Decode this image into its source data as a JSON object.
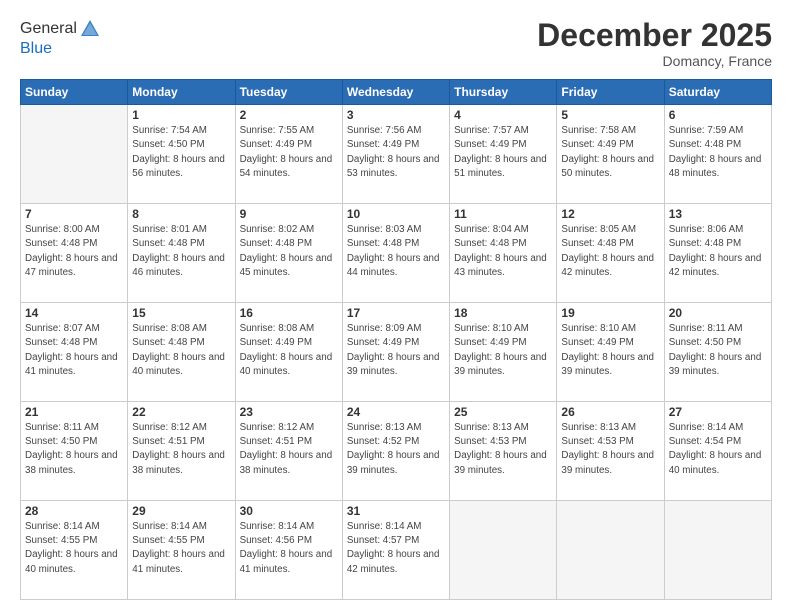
{
  "header": {
    "logo": {
      "line1": "General",
      "line2": "Blue"
    },
    "title": "December 2025",
    "location": "Domancy, France"
  },
  "calendar": {
    "weekdays": [
      "Sunday",
      "Monday",
      "Tuesday",
      "Wednesday",
      "Thursday",
      "Friday",
      "Saturday"
    ],
    "weeks": [
      [
        {
          "day": "",
          "empty": true
        },
        {
          "day": "1",
          "sunrise": "7:54 AM",
          "sunset": "4:50 PM",
          "daylight": "8 hours and 56 minutes."
        },
        {
          "day": "2",
          "sunrise": "7:55 AM",
          "sunset": "4:49 PM",
          "daylight": "8 hours and 54 minutes."
        },
        {
          "day": "3",
          "sunrise": "7:56 AM",
          "sunset": "4:49 PM",
          "daylight": "8 hours and 53 minutes."
        },
        {
          "day": "4",
          "sunrise": "7:57 AM",
          "sunset": "4:49 PM",
          "daylight": "8 hours and 51 minutes."
        },
        {
          "day": "5",
          "sunrise": "7:58 AM",
          "sunset": "4:49 PM",
          "daylight": "8 hours and 50 minutes."
        },
        {
          "day": "6",
          "sunrise": "7:59 AM",
          "sunset": "4:48 PM",
          "daylight": "8 hours and 48 minutes."
        }
      ],
      [
        {
          "day": "7",
          "sunrise": "8:00 AM",
          "sunset": "4:48 PM",
          "daylight": "8 hours and 47 minutes."
        },
        {
          "day": "8",
          "sunrise": "8:01 AM",
          "sunset": "4:48 PM",
          "daylight": "8 hours and 46 minutes."
        },
        {
          "day": "9",
          "sunrise": "8:02 AM",
          "sunset": "4:48 PM",
          "daylight": "8 hours and 45 minutes."
        },
        {
          "day": "10",
          "sunrise": "8:03 AM",
          "sunset": "4:48 PM",
          "daylight": "8 hours and 44 minutes."
        },
        {
          "day": "11",
          "sunrise": "8:04 AM",
          "sunset": "4:48 PM",
          "daylight": "8 hours and 43 minutes."
        },
        {
          "day": "12",
          "sunrise": "8:05 AM",
          "sunset": "4:48 PM",
          "daylight": "8 hours and 42 minutes."
        },
        {
          "day": "13",
          "sunrise": "8:06 AM",
          "sunset": "4:48 PM",
          "daylight": "8 hours and 42 minutes."
        }
      ],
      [
        {
          "day": "14",
          "sunrise": "8:07 AM",
          "sunset": "4:48 PM",
          "daylight": "8 hours and 41 minutes."
        },
        {
          "day": "15",
          "sunrise": "8:08 AM",
          "sunset": "4:48 PM",
          "daylight": "8 hours and 40 minutes."
        },
        {
          "day": "16",
          "sunrise": "8:08 AM",
          "sunset": "4:49 PM",
          "daylight": "8 hours and 40 minutes."
        },
        {
          "day": "17",
          "sunrise": "8:09 AM",
          "sunset": "4:49 PM",
          "daylight": "8 hours and 39 minutes."
        },
        {
          "day": "18",
          "sunrise": "8:10 AM",
          "sunset": "4:49 PM",
          "daylight": "8 hours and 39 minutes."
        },
        {
          "day": "19",
          "sunrise": "8:10 AM",
          "sunset": "4:49 PM",
          "daylight": "8 hours and 39 minutes."
        },
        {
          "day": "20",
          "sunrise": "8:11 AM",
          "sunset": "4:50 PM",
          "daylight": "8 hours and 39 minutes."
        }
      ],
      [
        {
          "day": "21",
          "sunrise": "8:11 AM",
          "sunset": "4:50 PM",
          "daylight": "8 hours and 38 minutes."
        },
        {
          "day": "22",
          "sunrise": "8:12 AM",
          "sunset": "4:51 PM",
          "daylight": "8 hours and 38 minutes."
        },
        {
          "day": "23",
          "sunrise": "8:12 AM",
          "sunset": "4:51 PM",
          "daylight": "8 hours and 38 minutes."
        },
        {
          "day": "24",
          "sunrise": "8:13 AM",
          "sunset": "4:52 PM",
          "daylight": "8 hours and 39 minutes."
        },
        {
          "day": "25",
          "sunrise": "8:13 AM",
          "sunset": "4:53 PM",
          "daylight": "8 hours and 39 minutes."
        },
        {
          "day": "26",
          "sunrise": "8:13 AM",
          "sunset": "4:53 PM",
          "daylight": "8 hours and 39 minutes."
        },
        {
          "day": "27",
          "sunrise": "8:14 AM",
          "sunset": "4:54 PM",
          "daylight": "8 hours and 40 minutes."
        }
      ],
      [
        {
          "day": "28",
          "sunrise": "8:14 AM",
          "sunset": "4:55 PM",
          "daylight": "8 hours and 40 minutes."
        },
        {
          "day": "29",
          "sunrise": "8:14 AM",
          "sunset": "4:55 PM",
          "daylight": "8 hours and 41 minutes."
        },
        {
          "day": "30",
          "sunrise": "8:14 AM",
          "sunset": "4:56 PM",
          "daylight": "8 hours and 41 minutes."
        },
        {
          "day": "31",
          "sunrise": "8:14 AM",
          "sunset": "4:57 PM",
          "daylight": "8 hours and 42 minutes."
        },
        {
          "day": "",
          "empty": true
        },
        {
          "day": "",
          "empty": true
        },
        {
          "day": "",
          "empty": true
        }
      ]
    ]
  }
}
